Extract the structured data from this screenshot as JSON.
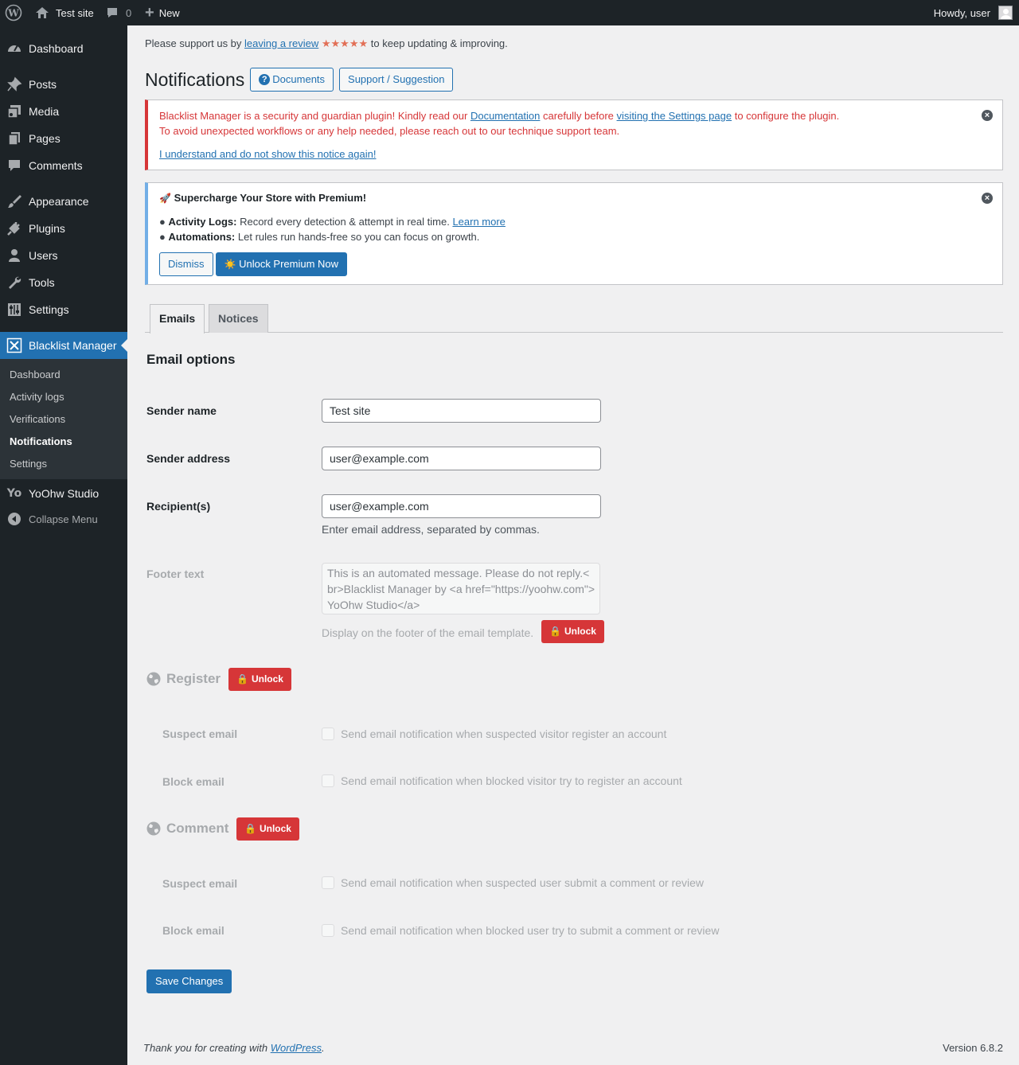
{
  "adminbar": {
    "site_name": "Test site",
    "comments_count": "0",
    "new_label": "New",
    "howdy": "Howdy, user"
  },
  "menu": {
    "items": [
      {
        "label": "Dashboard",
        "icon": "dashboard-icon"
      },
      {
        "label": "Posts",
        "icon": "pin-icon"
      },
      {
        "label": "Media",
        "icon": "media-icon"
      },
      {
        "label": "Pages",
        "icon": "pages-icon"
      },
      {
        "label": "Comments",
        "icon": "comments-icon"
      },
      {
        "label": "Appearance",
        "icon": "brush-icon"
      },
      {
        "label": "Plugins",
        "icon": "plugin-icon"
      },
      {
        "label": "Users",
        "icon": "users-icon"
      },
      {
        "label": "Tools",
        "icon": "wrench-icon"
      },
      {
        "label": "Settings",
        "icon": "sliders-icon"
      },
      {
        "label": "Blacklist Manager",
        "icon": "blacklist-icon"
      },
      {
        "label": "YoOhw Studio",
        "icon": "yo-icon"
      },
      {
        "label": "Collapse Menu",
        "icon": "collapse-icon"
      }
    ],
    "submenu": [
      "Dashboard",
      "Activity logs",
      "Verifications",
      "Notifications",
      "Settings"
    ]
  },
  "review": {
    "prefix": "Please support us by",
    "link": "leaving a review",
    "stars": "★★★★★",
    "suffix": "to keep updating & improving."
  },
  "page": {
    "title": "Notifications",
    "docs_button": "Documents",
    "support_button": "Support / Suggestion"
  },
  "notice1": {
    "t1": "Blacklist Manager is a security and guardian plugin! Kindly read our",
    "link1": "Documentation",
    "t2": "carefully before",
    "link2": "visiting the Settings page",
    "t3": "to configure the plugin.",
    "line2": "To avoid unexpected workflows or any help needed, please reach out to our technique support team.",
    "dismiss_link": "I understand and do not show this notice again!"
  },
  "notice2": {
    "emoji": "🚀",
    "title": "Supercharge Your Store with Premium!",
    "bullet": "●",
    "b1_label": "Activity Logs:",
    "b1_text": "Record every detection & attempt in real time.",
    "b1_link": "Learn more",
    "b2_label": "Automations:",
    "b2_text": "Let rules run hands-free so you can focus on growth.",
    "dismiss": "Dismiss",
    "sun": "☀️",
    "unlock": "Unlock Premium Now"
  },
  "tabs": [
    "Emails",
    "Notices"
  ],
  "email_options": {
    "heading": "Email options",
    "sender_name_label": "Sender name",
    "sender_name": "Test site",
    "sender_address_label": "Sender address",
    "sender_address": "user@example.com",
    "recipients_label": "Recipient(s)",
    "recipients": "user@example.com",
    "recipients_help": "Enter email address, separated by commas.",
    "footer_label": "Footer text",
    "footer_value": "This is an automated message. Please do not reply.<br>Blacklist Manager by <a href=\"https://yoohw.com\">YoOhw Studio</a>",
    "footer_help": "Display on the footer of the email template."
  },
  "unlock_label": "Unlock",
  "register": {
    "title": "Register",
    "suspect_label": "Suspect email",
    "suspect_text": "Send email notification when suspected visitor register an account",
    "block_label": "Block email",
    "block_text": "Send email notification when blocked visitor try to register an account"
  },
  "comment": {
    "title": "Comment",
    "suspect_label": "Suspect email",
    "suspect_text": "Send email notification when suspected user submit a comment or review",
    "block_label": "Block email",
    "block_text": "Send email notification when blocked user try to submit a comment or review"
  },
  "save_button": "Save Changes",
  "footer": {
    "thanks": "Thank you for creating with",
    "wp_link": "WordPress",
    "period": ".",
    "version": "Version 6.8.2"
  }
}
